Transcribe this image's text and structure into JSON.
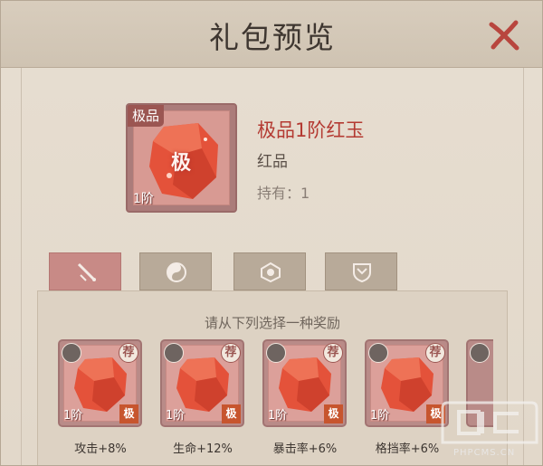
{
  "dialog": {
    "title": "礼包预览",
    "close_icon": "close-x-icon"
  },
  "item": {
    "grade_tag": "极品",
    "level": "1阶",
    "center_char": "极",
    "name": "极品1阶红玉",
    "quality": "红品",
    "owned": "持有：1"
  },
  "tabs": [
    {
      "icon": "sword-icon",
      "active": true
    },
    {
      "icon": "yin-yang-icon",
      "active": false
    },
    {
      "icon": "flower-emblem-icon",
      "active": false
    },
    {
      "icon": "shield-icon",
      "active": false
    }
  ],
  "rewards": {
    "prompt": "请从下列选择一种奖励",
    "items": [
      {
        "level": "1阶",
        "rec": "荐",
        "grade": "极",
        "label": "攻击+8%"
      },
      {
        "level": "1阶",
        "rec": "荐",
        "grade": "极",
        "label": "生命+12%"
      },
      {
        "level": "1阶",
        "rec": "荐",
        "grade": "极",
        "label": "暴击率+6%"
      },
      {
        "level": "1阶",
        "rec": "荐",
        "grade": "极",
        "label": "格挡率+6%"
      }
    ]
  },
  "watermark": {
    "text": "PHPCMS.CN"
  },
  "colors": {
    "accent_red": "#b43a32",
    "panel": "#e4dacc",
    "active_tab": "#c88a86"
  }
}
